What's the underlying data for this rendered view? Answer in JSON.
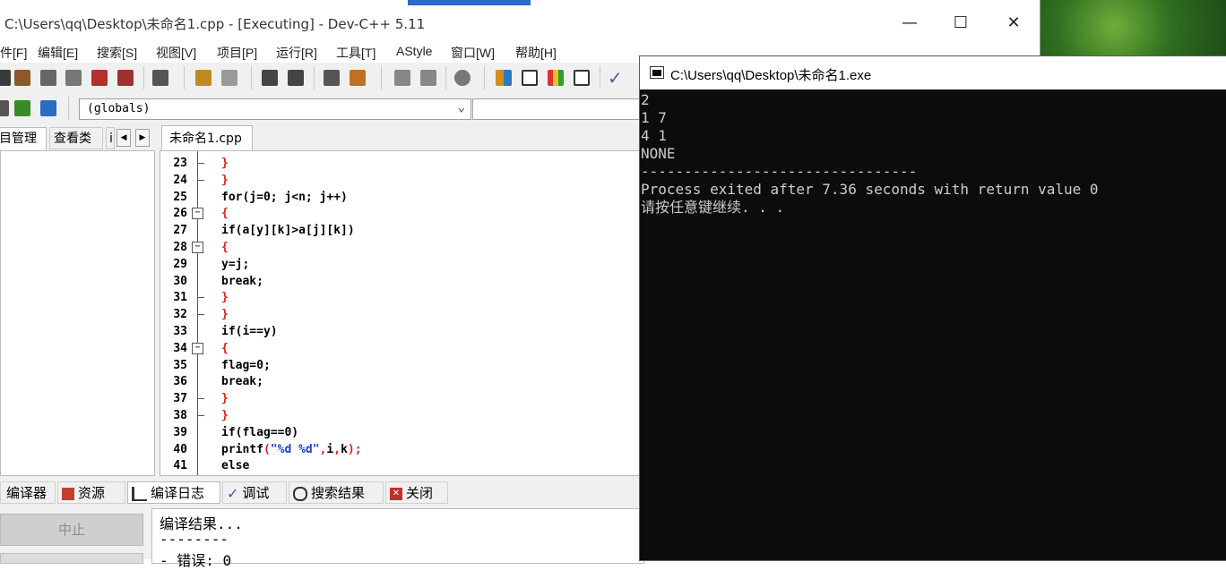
{
  "ide": {
    "title": "C:\\Users\\qq\\Desktop\\未命名1.cpp - [Executing] - Dev-C++ 5.11",
    "window_controls": {
      "minimize": "—",
      "maximize": "☐",
      "close": "✕"
    },
    "menu": [
      "件[F]",
      "编辑[E]",
      "搜索[S]",
      "视图[V]",
      "项目[P]",
      "运行[R]",
      "工具[T]",
      "AStyle",
      "窗口[W]",
      "帮助[H]"
    ],
    "scope_select": "(globals)",
    "left_tabs": [
      "目管理",
      "查看类",
      "i"
    ],
    "editor_tab": "未命名1.cpp",
    "code_lines": [
      {
        "n": "23",
        "text": "}",
        "color": "#e02020",
        "fold": "tee"
      },
      {
        "n": "24",
        "text": "}",
        "color": "#e02020",
        "fold": "tee"
      },
      {
        "n": "25",
        "text": "for(j=0; j<n; j++)",
        "color": "#000000",
        "fold": "line"
      },
      {
        "n": "26",
        "text": "{",
        "color": "#e02020",
        "fold": "box"
      },
      {
        "n": "27",
        "text": "if(a[y][k]>a[j][k])",
        "color": "#000000",
        "fold": "line"
      },
      {
        "n": "28",
        "text": "{",
        "color": "#e02020",
        "fold": "box"
      },
      {
        "n": "29",
        "text": "y=j;",
        "color": "#000000",
        "fold": "line"
      },
      {
        "n": "30",
        "text": "break;",
        "color": "#000000",
        "fold": "line"
      },
      {
        "n": "31",
        "text": "}",
        "color": "#e02020",
        "fold": "tee"
      },
      {
        "n": "32",
        "text": "}",
        "color": "#e02020",
        "fold": "tee"
      },
      {
        "n": "33",
        "text": "if(i==y)",
        "color": "#000000",
        "fold": "line"
      },
      {
        "n": "34",
        "text": "{",
        "color": "#e02020",
        "fold": "box"
      },
      {
        "n": "35",
        "text": "flag=0;",
        "color": "#000000",
        "fold": "line"
      },
      {
        "n": "36",
        "text": "break;",
        "color": "#000000",
        "fold": "line"
      },
      {
        "n": "37",
        "text": "}",
        "color": "#e02020",
        "fold": "tee"
      },
      {
        "n": "38",
        "text": "}",
        "color": "#e02020",
        "fold": "tee"
      },
      {
        "n": "39",
        "text": "if(flag==0)",
        "color": "#000000",
        "fold": "line"
      },
      {
        "n": "40",
        "text": "printf(\"%d %d\",i,k);",
        "color": "#000000",
        "fold": "line"
      },
      {
        "n": "41",
        "text": "else",
        "color": "#000000",
        "fold": "line"
      }
    ],
    "bottom_tabs": [
      "编译器",
      "资源",
      "编译日志",
      "调试",
      "搜索结果",
      "关闭"
    ],
    "stop_button": "中止",
    "log_lines": [
      "编译结果...",
      "--------",
      "- 错误: 0"
    ]
  },
  "console": {
    "title": "C:\\Users\\qq\\Desktop\\未命名1.exe",
    "lines": [
      "2",
      "1 7",
      "4 1",
      "NONE",
      "--------------------------------",
      "Process exited after 7.36 seconds with return value 0",
      "请按任意键继续. . ."
    ]
  },
  "colors": {
    "keyword_red": "#e02020",
    "string_blue": "#1a3fd0",
    "console_bg": "#0c0c0c",
    "console_text": "#cccccc"
  }
}
